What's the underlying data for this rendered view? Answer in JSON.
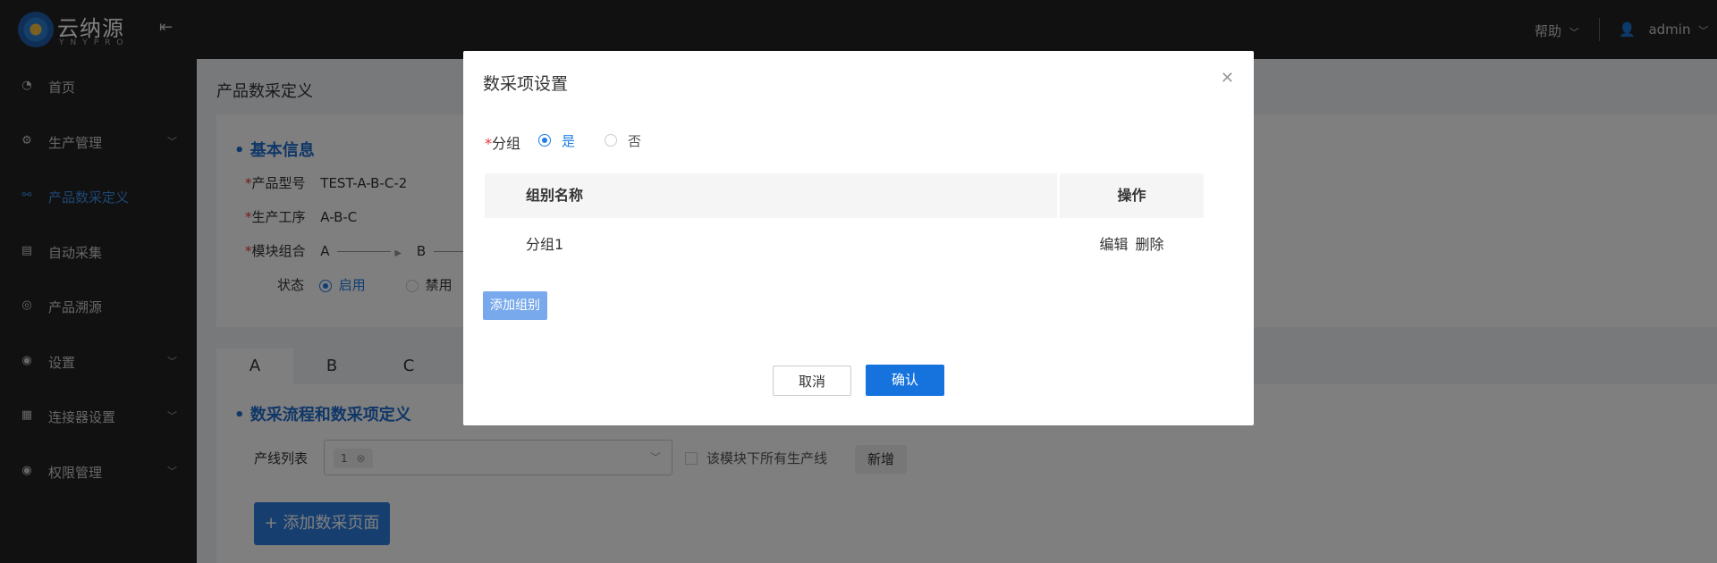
{
  "header": {
    "logo_text": "云纳源",
    "logo_sub": "YNYPRO",
    "help_label": "帮助",
    "user_label": "admin"
  },
  "sidebar": {
    "items": [
      {
        "label": "首页",
        "icon": "dashboard-icon",
        "expandable": false,
        "active": false
      },
      {
        "label": "生产管理",
        "icon": "gear-icon",
        "expandable": true,
        "active": false
      },
      {
        "label": "产品数采定义",
        "icon": "link-icon",
        "expandable": false,
        "active": true
      },
      {
        "label": "自动采集",
        "icon": "book-icon",
        "expandable": false,
        "active": false
      },
      {
        "label": "产品溯源",
        "icon": "trace-icon",
        "expandable": false,
        "active": false
      },
      {
        "label": "设置",
        "icon": "settings-icon",
        "expandable": true,
        "active": false
      },
      {
        "label": "连接器设置",
        "icon": "connector-icon",
        "expandable": true,
        "active": false
      },
      {
        "label": "权限管理",
        "icon": "permission-icon",
        "expandable": true,
        "active": false
      }
    ]
  },
  "page": {
    "title": "产品数采定义",
    "basic_info_title": "• 基本信息",
    "product_model_label": "产品型号",
    "product_model_value": "TEST-A-B-C-2",
    "process_label": "生产工序",
    "process_value": "A-B-C",
    "module_label": "模块组合",
    "module_a": "A",
    "module_b": "B",
    "status_label": "状态",
    "status_enabled": "启用",
    "status_disabled": "禁用",
    "tabs": [
      "A",
      "B",
      "C"
    ],
    "flow_title": "• 数采流程和数采项定义",
    "line_list_label": "产线列表",
    "line_chip": "1",
    "all_lines_label": "该模块下所有生产线",
    "add_new_label": "新增",
    "add_page_label": "+ 添加数采页面"
  },
  "modal": {
    "title": "数采项设置",
    "group_label": "分组",
    "yes_label": "是",
    "no_label": "否",
    "col_name": "组别名称",
    "col_action": "操作",
    "rows": [
      {
        "name": "分组1",
        "edit": "编辑",
        "delete": "删除"
      }
    ],
    "add_group_label": "添加组别",
    "cancel_label": "取消",
    "ok_label": "确认"
  },
  "colors": {
    "primary": "#1673de",
    "sidebar_bg": "#222324",
    "active_nav": "#3d8fe6",
    "section_title": "#1f6fd0"
  }
}
